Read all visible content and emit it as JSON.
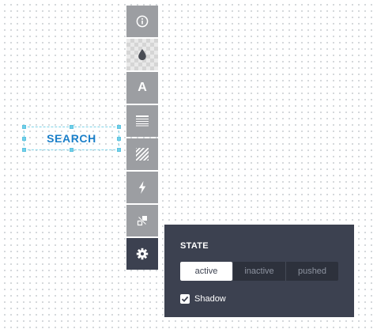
{
  "canvas": {
    "widget": {
      "label": "SEARCH"
    }
  },
  "toolbar": {
    "tools": [
      {
        "name": "info",
        "icon": "info-icon"
      },
      {
        "name": "color",
        "icon": "droplet-icon"
      },
      {
        "name": "text",
        "icon": "text-a-icon",
        "glyph": "A"
      },
      {
        "name": "fill",
        "icon": "horizontal-lines-icon"
      },
      {
        "name": "pattern",
        "icon": "diagonal-stripes-icon"
      },
      {
        "name": "actions",
        "icon": "lightning-icon"
      },
      {
        "name": "interactions",
        "icon": "hotspot-icon"
      },
      {
        "name": "settings",
        "icon": "gear-icon",
        "active": true
      }
    ]
  },
  "panel": {
    "title": "STATE",
    "state_options": [
      "active",
      "inactive",
      "pushed"
    ],
    "selected_state": "active",
    "shadow": {
      "label": "Shadow",
      "checked": true
    }
  },
  "colors": {
    "toolbar_button": "#9c9ea2",
    "toolbar_active": "#3c4150",
    "panel_bg": "#3c4150",
    "widget_text": "#1a7fc9",
    "selection_handle": "#6fd0ea"
  }
}
